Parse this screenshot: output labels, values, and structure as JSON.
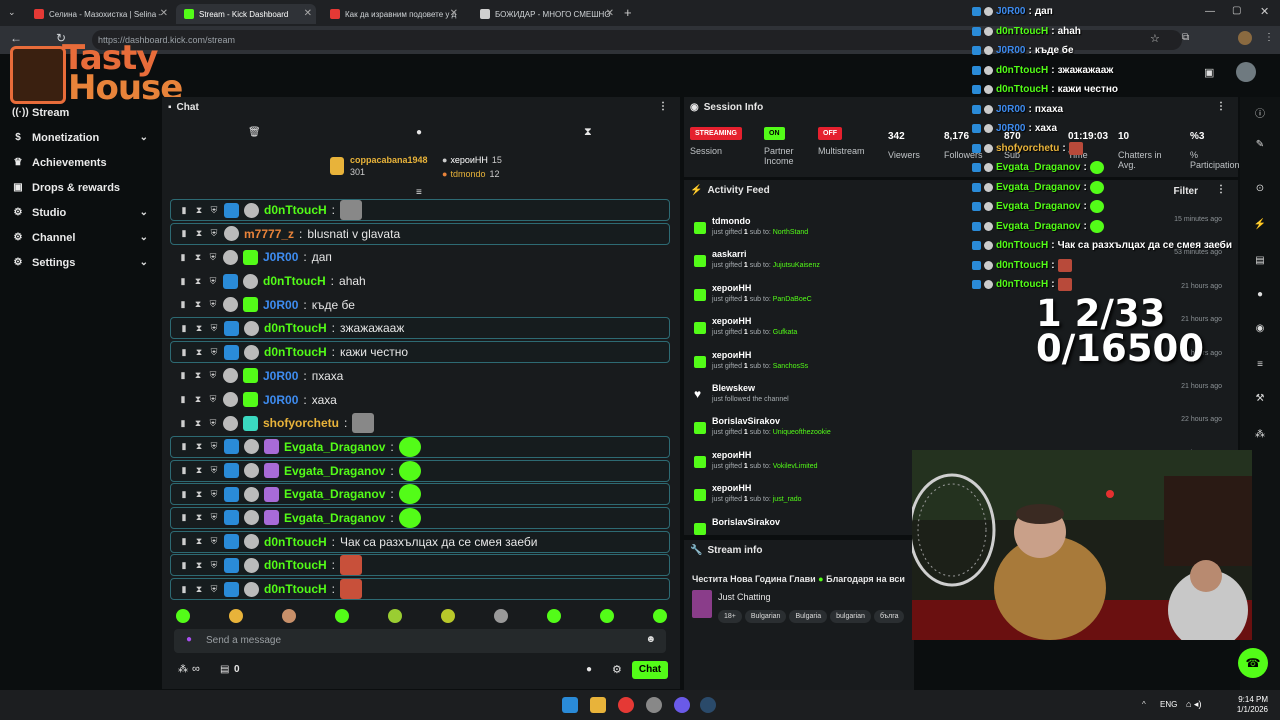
{
  "browser": {
    "tabs": [
      {
        "title": "Селина - Мазохистка | Selina -",
        "color": "#e53935"
      },
      {
        "title": "Stream - Kick Dashboard",
        "color": "#53fc18"
      },
      {
        "title": "Как да изравним подовете у д",
        "color": "#e53935"
      },
      {
        "title": "БОЖИДАР - МНОГО СМЕШНО",
        "color": "#cfcfcf"
      }
    ],
    "url": "https://dashboard.kick.com/stream"
  },
  "logo": {
    "line1": "Tasty",
    "line2": "House"
  },
  "sidebar": {
    "items": [
      {
        "label": "Stream",
        "icon": "stream-icon",
        "chev": false
      },
      {
        "label": "Monetization",
        "icon": "dollar-icon",
        "chev": true
      },
      {
        "label": "Achievements",
        "icon": "trophy-icon",
        "chev": false
      },
      {
        "label": "Drops & rewards",
        "icon": "gift-icon",
        "chev": false
      },
      {
        "label": "Studio",
        "icon": "studio-icon",
        "chev": true
      },
      {
        "label": "Channel",
        "icon": "channel-icon",
        "chev": true
      },
      {
        "label": "Settings",
        "icon": "gear-icon",
        "chev": true
      }
    ]
  },
  "chat": {
    "title": "Chat",
    "gifters": [
      {
        "name": "coppacabana1948",
        "count": "301"
      },
      {
        "name": "хероиНН",
        "count": "15"
      },
      {
        "name": "tdmondo",
        "count": "12"
      }
    ],
    "messages": [
      {
        "user": "d0nTtoucH",
        "text": "",
        "color": "#53fc18",
        "hl": true,
        "emote": true
      },
      {
        "user": "m7777_z",
        "text": "blusnati v glavata",
        "color": "#e8833a",
        "hl": true,
        "emote": false
      },
      {
        "user": "J0R00",
        "text": "дап",
        "color": "#3e8cf0",
        "hl": false,
        "emote": false
      },
      {
        "user": "d0nTtoucH",
        "text": "ahah",
        "color": "#53fc18",
        "hl": false,
        "emote": false
      },
      {
        "user": "J0R00",
        "text": "къде бе",
        "color": "#3e8cf0",
        "hl": false,
        "emote": false
      },
      {
        "user": "d0nTtoucH",
        "text": "зжажажааж",
        "color": "#53fc18",
        "hl": true,
        "emote": false
      },
      {
        "user": "d0nTtoucH",
        "text": "кажи честно",
        "color": "#53fc18",
        "hl": true,
        "emote": false
      },
      {
        "user": "J0R00",
        "text": "пхаха",
        "color": "#3e8cf0",
        "hl": false,
        "emote": false
      },
      {
        "user": "J0R00",
        "text": "хаха",
        "color": "#3e8cf0",
        "hl": false,
        "emote": false
      },
      {
        "user": "shofyorchetu",
        "text": "",
        "color": "#e8b33a",
        "hl": false,
        "emote": true
      },
      {
        "user": "Evgata_Draganov",
        "text": "",
        "color": "#53fc18",
        "hl": true,
        "emote": true
      },
      {
        "user": "Evgata_Draganov",
        "text": "",
        "color": "#53fc18",
        "hl": true,
        "emote": true
      },
      {
        "user": "Evgata_Draganov",
        "text": "",
        "color": "#53fc18",
        "hl": true,
        "emote": true
      },
      {
        "user": "Evgata_Draganov",
        "text": "",
        "color": "#53fc18",
        "hl": true,
        "emote": true
      },
      {
        "user": "d0nTtoucH",
        "text": "Чак са разхълцах да се смея заеби",
        "color": "#53fc18",
        "hl": true,
        "emote": false
      },
      {
        "user": "d0nTtoucH",
        "text": "",
        "color": "#53fc18",
        "hl": true,
        "emote": true
      },
      {
        "user": "d0nTtoucH",
        "text": "",
        "color": "#53fc18",
        "hl": true,
        "emote": true
      }
    ],
    "placeholder": "Send a message",
    "viewers_icon": "∞",
    "counter": "0",
    "chat_button": "Chat"
  },
  "session": {
    "title": "Session Info",
    "columns": [
      {
        "value": "STREAMING",
        "label": "Session",
        "kind": "tag",
        "color": "#e5202e"
      },
      {
        "value": "ON",
        "label": "Partner Income",
        "kind": "tag",
        "color": "#53fc18"
      },
      {
        "value": "OFF",
        "label": "Multistream",
        "kind": "tag",
        "color": "#e5202e"
      },
      {
        "value": "342",
        "label": "Viewers",
        "kind": "num"
      },
      {
        "value": "8,176",
        "label": "Followers",
        "kind": "num"
      },
      {
        "value": "870",
        "label": "Sub",
        "kind": "num"
      },
      {
        "value": "01:19:03",
        "label": "Time",
        "kind": "num"
      },
      {
        "value": "10",
        "label": "Chatters in Avg.",
        "kind": "num"
      },
      {
        "value": "%3",
        "label": "% Participation",
        "kind": "num"
      }
    ]
  },
  "activity": {
    "title": "Activity Feed",
    "filter": "Filter",
    "items": [
      {
        "name": "tdmondo",
        "pre": "just gifted",
        "n": "1",
        "mid": "sub to:",
        "to": "NorthStand",
        "time": "15 minutes ago",
        "kind": "gift"
      },
      {
        "name": "aaskarri",
        "pre": "just gifted",
        "n": "1",
        "mid": "sub to:",
        "to": "JujutsuKaisenz",
        "time": "53 minutes ago",
        "kind": "gift"
      },
      {
        "name": "хероиНН",
        "pre": "just gifted",
        "n": "1",
        "mid": "sub to:",
        "to": "PanDaBoeC",
        "time": "21 hours ago",
        "kind": "gift"
      },
      {
        "name": "хероиНН",
        "pre": "just gifted",
        "n": "1",
        "mid": "sub to:",
        "to": "Gufkata",
        "time": "21 hours ago",
        "kind": "gift"
      },
      {
        "name": "хероиНН",
        "pre": "just gifted",
        "n": "1",
        "mid": "sub to:",
        "to": "SanchosSs",
        "time": "21 hours ago",
        "kind": "gift"
      },
      {
        "name": "Blewskew",
        "pre": "just followed the channel",
        "n": "",
        "mid": "",
        "to": "",
        "time": "21 hours ago",
        "kind": "follow"
      },
      {
        "name": "BorislavSirakov",
        "pre": "just gifted",
        "n": "1",
        "mid": "sub to:",
        "to": "Uniqueofthezookie",
        "time": "22 hours ago",
        "kind": "gift"
      },
      {
        "name": "хероиНН",
        "pre": "just gifted",
        "n": "1",
        "mid": "sub to:",
        "to": "VokilevLimited",
        "time": "21 hours ago",
        "kind": "gift"
      },
      {
        "name": "хероиНН",
        "pre": "just gifted",
        "n": "1",
        "mid": "sub to:",
        "to": "just_rado",
        "time": "21 hours ago",
        "kind": "gift"
      },
      {
        "name": "BorislavSirakov",
        "pre": "",
        "n": "",
        "mid": "",
        "to": "",
        "time": "",
        "kind": "gift"
      }
    ]
  },
  "streaminfo": {
    "title": "Stream info",
    "stream_title": "Честита Нова Година Глави",
    "stream_title2": "Благодаря на вси",
    "category": "Just Chatting",
    "tags": [
      "18+",
      "Bulgarian",
      "Bulgaria",
      "bulgarian",
      "бълга"
    ]
  },
  "overlay": {
    "messages": [
      {
        "user": "J0R00",
        "text": "дап",
        "color": "#3e8cf0"
      },
      {
        "user": "d0nTtoucH",
        "text": "ahah",
        "color": "#53fc18"
      },
      {
        "user": "J0R00",
        "text": "къде бе",
        "color": "#3e8cf0"
      },
      {
        "user": "d0nTtoucH",
        "text": "зжажажааж",
        "color": "#53fc18"
      },
      {
        "user": "d0nTtoucH",
        "text": "кажи честно",
        "color": "#53fc18"
      },
      {
        "user": "J0R00",
        "text": "пхаха",
        "color": "#3e8cf0"
      },
      {
        "user": "J0R00",
        "text": "хаха",
        "color": "#3e8cf0"
      },
      {
        "user": "shofyorchetu",
        "text": "",
        "color": "#e8b33a"
      },
      {
        "user": "Evgata_Draganov",
        "text": "",
        "color": "#53fc18"
      },
      {
        "user": "Evgata_Draganov",
        "text": "",
        "color": "#53fc18"
      },
      {
        "user": "Evgata_Draganov",
        "text": "",
        "color": "#53fc18"
      },
      {
        "user": "Evgata_Draganov",
        "text": "",
        "color": "#53fc18"
      },
      {
        "user": "d0nTtoucH",
        "text": "Чак са разхълцах да се смея заеби",
        "color": "#53fc18"
      },
      {
        "user": "d0nTtoucH",
        "text": "",
        "color": "#53fc18"
      },
      {
        "user": "d0nTtoucH",
        "text": "",
        "color": "#53fc18"
      }
    ],
    "goal_line1": "1 2/33",
    "goal_line2": "0/16500"
  },
  "taskbar": {
    "lang": "ENG",
    "time": "9:14 PM",
    "date": "1/1/2026"
  }
}
